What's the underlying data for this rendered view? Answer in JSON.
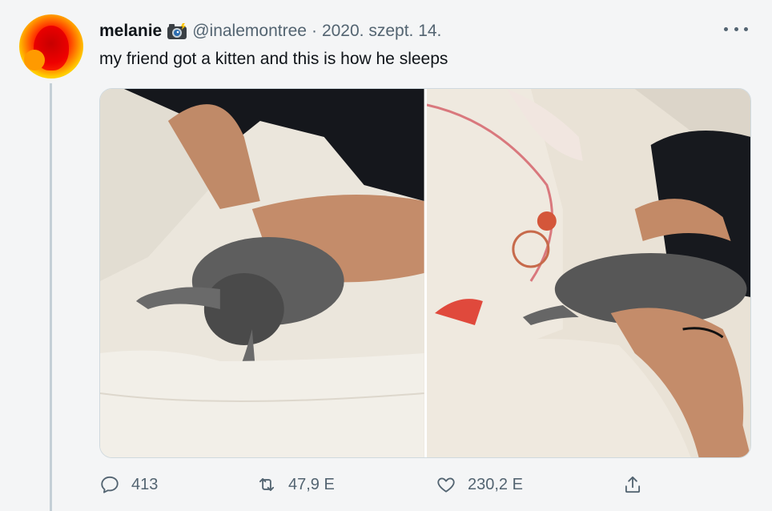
{
  "tweet": {
    "display_name": "melanie",
    "name_emoji": "camera-with-flash-icon",
    "handle": "@inalemontree",
    "separator": "·",
    "date": "2020. szept. 14.",
    "text": "my friend got a kitten and this is how he sleeps",
    "images": [
      {
        "description_icon": "kitten-photo-left"
      },
      {
        "description_icon": "kitten-photo-right"
      }
    ]
  },
  "actions": {
    "reply_count": "413",
    "retweet_count": "47,9 E",
    "like_count": "230,2 E",
    "reply_icon": "reply-icon",
    "retweet_icon": "retweet-icon",
    "like_icon": "heart-icon",
    "share_icon": "share-icon"
  },
  "colors": {
    "background": "#f4f5f6",
    "text_primary": "#0f1419",
    "text_secondary": "#536471",
    "thread_line": "#c4cfd6"
  }
}
